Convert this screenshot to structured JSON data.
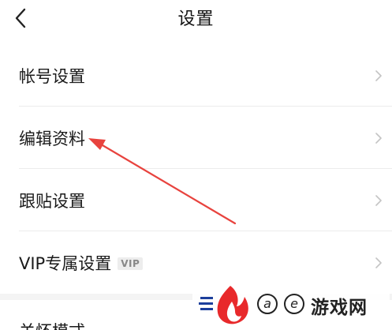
{
  "header": {
    "title": "设置",
    "back_icon": "chevron-left-icon"
  },
  "settings": {
    "items": [
      {
        "label": "帐号设置"
      },
      {
        "label": "编辑资料"
      },
      {
        "label": "跟贴设置"
      },
      {
        "label": "VIP专属设置",
        "badge": "VIP"
      }
    ],
    "partial_item": {
      "label": "关怀模式"
    }
  },
  "watermark": {
    "circle_1": "a",
    "circle_2": "e",
    "text": "游戏网"
  },
  "colors": {
    "annotation_arrow": "#e8433e",
    "chevron": "#c4c4c4",
    "divider": "#ececec",
    "watermark_flame": "#e8292b",
    "watermark_blue": "#1c3f9c"
  }
}
